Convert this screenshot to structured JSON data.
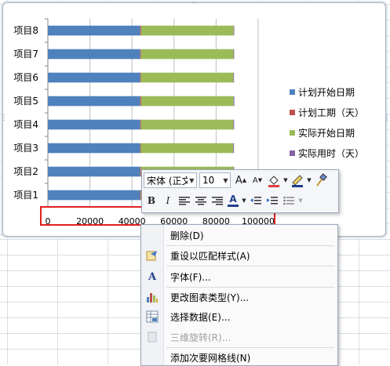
{
  "chart_data": {
    "type": "bar",
    "orientation": "horizontal",
    "stacked": true,
    "categories": [
      "项目1",
      "项目2",
      "项目3",
      "项目4",
      "项目5",
      "项目6",
      "项目7",
      "项目8"
    ],
    "series": [
      {
        "name": "计划开始日期",
        "color": "#4f81bd",
        "values": [
          43900,
          43900,
          43900,
          43900,
          43900,
          43900,
          43900,
          43900
        ]
      },
      {
        "name": "计划工期（天）",
        "color": "#c0504d",
        "values": [
          350,
          400,
          300,
          350,
          450,
          350,
          400,
          450
        ]
      },
      {
        "name": "实际开始日期",
        "color": "#9bbb59",
        "values": [
          43950,
          43950,
          43950,
          43950,
          43950,
          43950,
          43950,
          43950
        ]
      },
      {
        "name": "实际用时（天）",
        "color": "#8064a2",
        "values": [
          300,
          300,
          350,
          350,
          350,
          300,
          300,
          300
        ]
      }
    ],
    "xlim": [
      0,
      100000
    ],
    "ticks": [
      "0",
      "20000",
      "40000",
      "60000",
      "80000",
      "100000"
    ],
    "legend_position": "right",
    "grid": true
  },
  "mini_toolbar": {
    "font_name": "宋体 (正文)",
    "font_size": "10",
    "bold": "B",
    "italic": "I",
    "font_color_label": "A"
  },
  "context_menu": {
    "items": [
      {
        "label": "删除(D)",
        "icon": "none-icon",
        "enabled": true
      },
      {
        "label": "重设以匹配样式(A)",
        "icon": "reset-style-icon",
        "enabled": true
      },
      {
        "label": "字体(F)...",
        "icon": "font-icon",
        "enabled": true
      },
      {
        "label": "更改图表类型(Y)...",
        "icon": "chart-type-icon",
        "enabled": true
      },
      {
        "label": "选择数据(E)...",
        "icon": "select-data-icon",
        "enabled": true
      },
      {
        "label": "三维旋转(R)...",
        "icon": "rotate-3d-icon",
        "enabled": false
      },
      {
        "label": "添加次要网格线(N)",
        "icon": "none-icon",
        "enabled": true
      }
    ]
  }
}
